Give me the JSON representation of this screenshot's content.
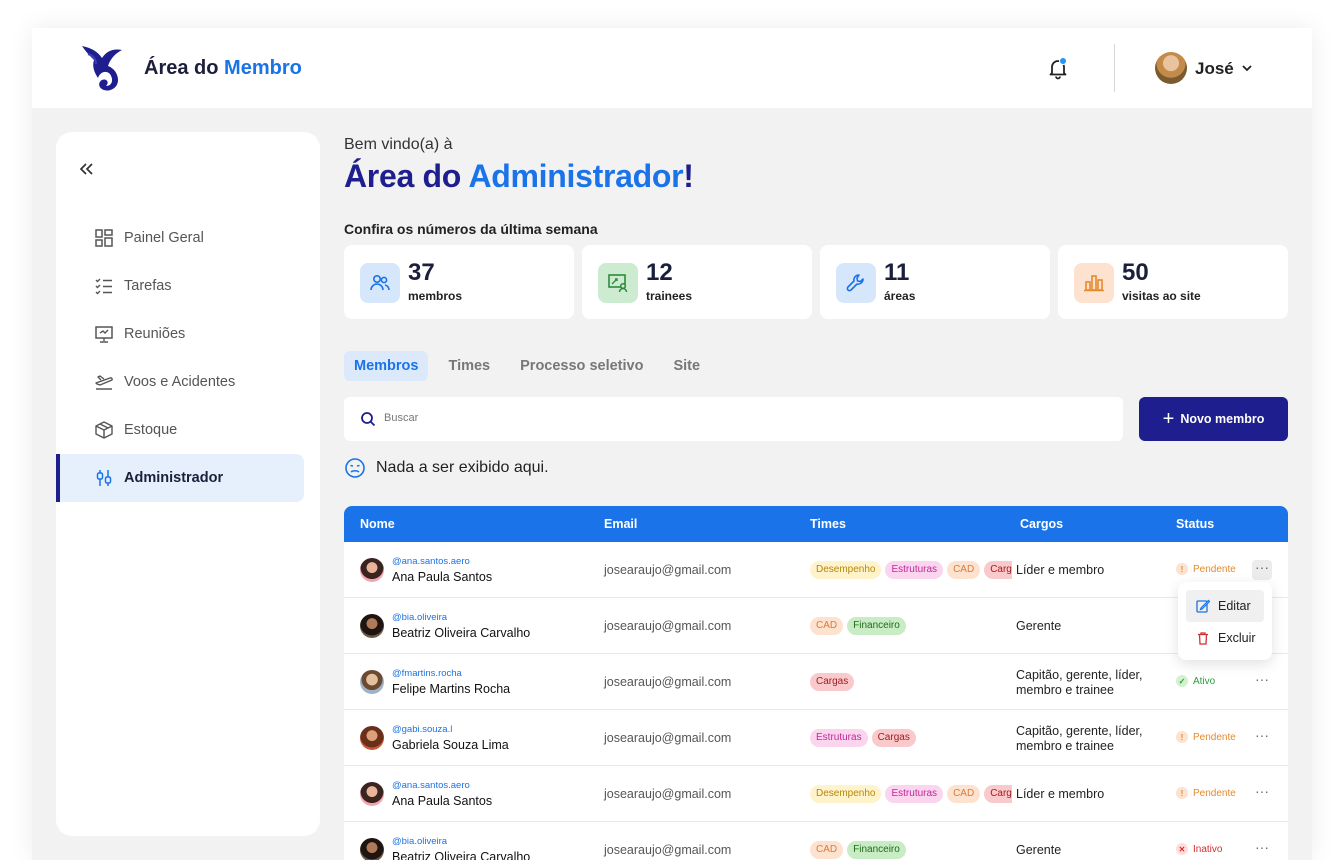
{
  "header": {
    "title_part1": "Área do ",
    "title_part2": "Membro",
    "user_name": "José"
  },
  "sidebar": {
    "items": [
      {
        "label": "Painel Geral",
        "icon": "grid-icon"
      },
      {
        "label": "Tarefas",
        "icon": "checklist-icon"
      },
      {
        "label": "Reuniões",
        "icon": "presentation-icon"
      },
      {
        "label": "Voos e Acidentes",
        "icon": "plane-icon"
      },
      {
        "label": "Estoque",
        "icon": "box-icon"
      },
      {
        "label": "Administrador",
        "icon": "sliders-icon",
        "active": true
      }
    ]
  },
  "main": {
    "welcome": "Bem vindo(a) à",
    "heading_part1": "Área do ",
    "heading_part2": "Administrador",
    "heading_part3": "!",
    "week_label": "Confira os números da última semana",
    "stats": [
      {
        "value": "37",
        "label": "membros",
        "icon": "users-icon",
        "color": "#d6e6fb"
      },
      {
        "value": "12",
        "label": "trainees",
        "icon": "trainee-icon",
        "color": "#cdebd0"
      },
      {
        "value": "11",
        "label": "áreas",
        "icon": "wrench-icon",
        "color": "#d6e6fb"
      },
      {
        "value": "50",
        "label": "visitas ao site",
        "icon": "bar-chart-icon",
        "color": "#fde2cf"
      }
    ],
    "tabs": [
      "Membros",
      "Times",
      "Processo seletivo",
      "Site"
    ],
    "search_placeholder": "Buscar",
    "new_button": "Novo membro",
    "empty_message": "Nada a ser exibido aqui."
  },
  "table": {
    "columns": [
      "Nome",
      "Email",
      "Times",
      "Cargos",
      "Status"
    ],
    "rows": [
      {
        "handle": "@ana.santos.aero",
        "name": "Ana Paula Santos",
        "email": "josearaujo@gmail.com",
        "teams": [
          "Desempenho",
          "Estruturas",
          "CAD",
          "Cargas"
        ],
        "role": "Líder e membro",
        "status": "Pendente"
      },
      {
        "handle": "@bia.oliveira",
        "name": "Beatriz Oliveira Carvalho",
        "email": "josearaujo@gmail.com",
        "teams": [
          "CAD",
          "Financeiro"
        ],
        "role": "Gerente",
        "status": ""
      },
      {
        "handle": "@fmartins.rocha",
        "name": "Felipe Martins Rocha",
        "email": "josearaujo@gmail.com",
        "teams": [
          "Cargas"
        ],
        "role": "Capitão, gerente, líder, membro e trainee",
        "status": "Ativo"
      },
      {
        "handle": "@gabi.souza.l",
        "name": "Gabriela Souza Lima",
        "email": "josearaujo@gmail.com",
        "teams": [
          "Estruturas",
          "Cargas"
        ],
        "role": "Capitão, gerente, líder, membro e trainee",
        "status": "Pendente"
      },
      {
        "handle": "@ana.santos.aero",
        "name": "Ana Paula Santos",
        "email": "josearaujo@gmail.com",
        "teams": [
          "Desempenho",
          "Estruturas",
          "CAD",
          "Cargas"
        ],
        "role": "Líder e membro",
        "status": "Pendente"
      },
      {
        "handle": "@bia.oliveira",
        "name": "Beatriz Oliveira Carvalho",
        "email": "josearaujo@gmail.com",
        "teams": [
          "CAD",
          "Financeiro"
        ],
        "role": "Gerente",
        "status": "Inativo"
      }
    ]
  },
  "row_menu": {
    "edit": "Editar",
    "delete": "Excluir"
  }
}
